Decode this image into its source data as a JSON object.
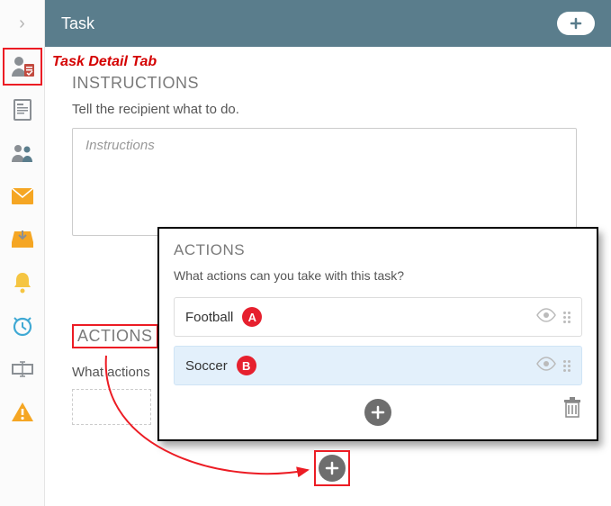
{
  "header": {
    "title": "Task"
  },
  "annotation": {
    "task_detail_tab": "Task Detail Tab"
  },
  "instructions": {
    "heading": "INSTRUCTIONS",
    "subtitle": "Tell the recipient what to do.",
    "placeholder": "Instructions"
  },
  "actions_bg": {
    "heading": "ACTIONS",
    "subtitle": "What actions"
  },
  "popup": {
    "heading": "ACTIONS",
    "subtitle": "What actions can you take with this task?",
    "rows": [
      {
        "label": "Football",
        "badge": "A"
      },
      {
        "label": "Soccer",
        "badge": "B"
      }
    ]
  },
  "icons": {
    "chevron": "›",
    "plus": "+",
    "eye": "👁",
    "trash": "🗑"
  }
}
